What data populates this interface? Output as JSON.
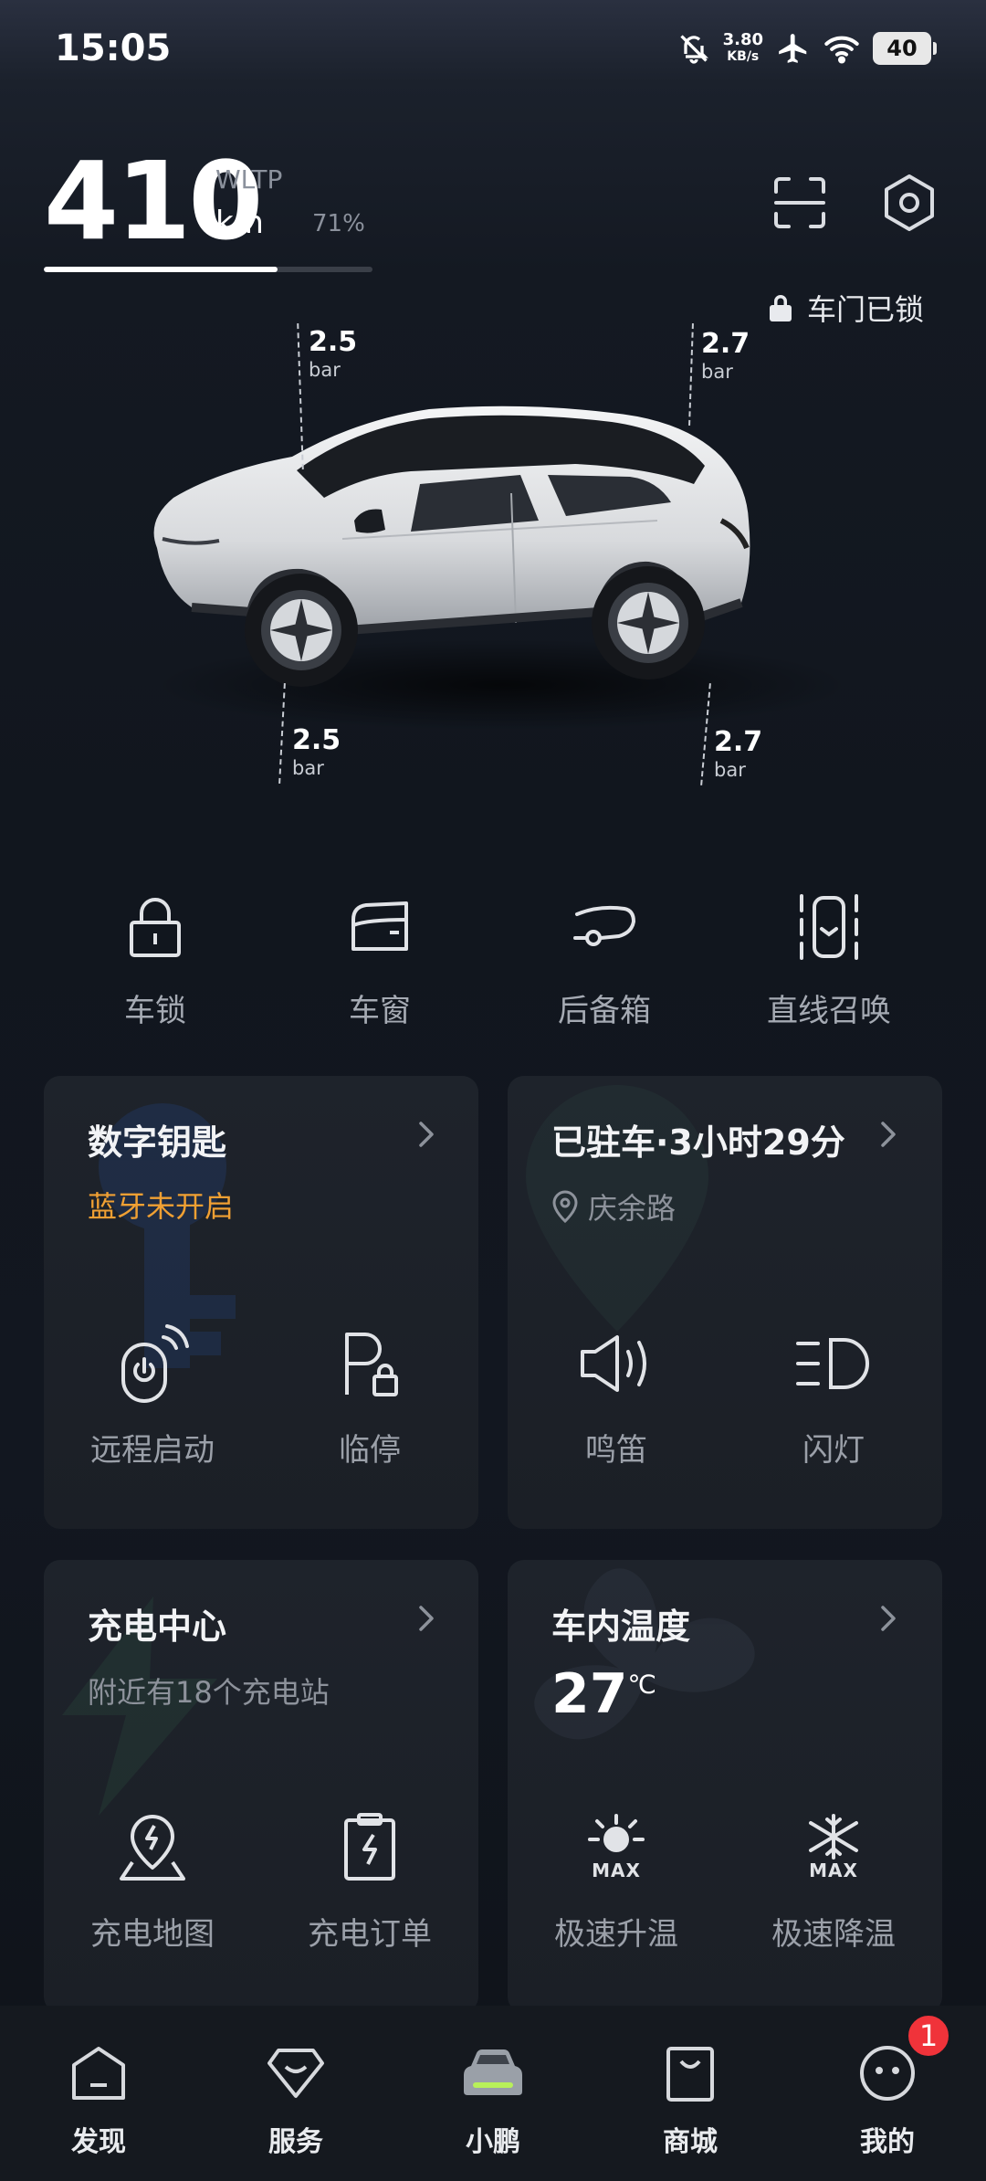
{
  "status_bar": {
    "time": "15:05",
    "net_speed": "3.80",
    "net_speed_unit": "KB/s",
    "battery": "40",
    "icons": [
      "mute-bell-icon",
      "airplane-icon",
      "wifi-icon",
      "battery-icon"
    ]
  },
  "range": {
    "value": "410",
    "standard": "WLTP",
    "unit": "km",
    "percent_label": "71%",
    "percent": 71
  },
  "door_status": "车门已锁",
  "tires": {
    "front_top": {
      "value": "2.5",
      "unit": "bar"
    },
    "rear_top": {
      "value": "2.7",
      "unit": "bar"
    },
    "front_bottom": {
      "value": "2.5",
      "unit": "bar"
    },
    "rear_bottom": {
      "value": "2.7",
      "unit": "bar"
    }
  },
  "quick_actions": [
    {
      "label": "车锁",
      "icon": "lock-icon"
    },
    {
      "label": "车窗",
      "icon": "window-icon"
    },
    {
      "label": "后备箱",
      "icon": "trunk-icon"
    },
    {
      "label": "直线召唤",
      "icon": "summon-icon"
    }
  ],
  "cards": {
    "digital_key": {
      "title": "数字钥匙",
      "status": "蓝牙未开启",
      "actions": [
        {
          "label": "远程启动",
          "icon": "remote-start-icon"
        },
        {
          "label": "临停",
          "icon": "temporary-park-icon"
        }
      ]
    },
    "parking": {
      "title": "已驻车·3小时29分",
      "location": "庆余路",
      "actions": [
        {
          "label": "鸣笛",
          "icon": "horn-icon"
        },
        {
          "label": "闪灯",
          "icon": "flash-lights-icon"
        }
      ]
    },
    "charging": {
      "title": "充电中心",
      "subtitle": "附近有18个充电站",
      "actions": [
        {
          "label": "充电地图",
          "icon": "charging-map-icon"
        },
        {
          "label": "充电订单",
          "icon": "charging-order-icon"
        }
      ]
    },
    "climate": {
      "title": "车内温度",
      "temperature": "27",
      "temp_unit": "℃",
      "actions": [
        {
          "label": "极速升温",
          "icon": "max-heat-icon",
          "badge": "MAX"
        },
        {
          "label": "极速降温",
          "icon": "max-cool-icon",
          "badge": "MAX"
        }
      ]
    }
  },
  "bottom_nav": [
    {
      "label": "发现",
      "icon": "discover-icon"
    },
    {
      "label": "服务",
      "icon": "service-icon"
    },
    {
      "label": "小鹏",
      "icon": "car-icon",
      "active": true
    },
    {
      "label": "商城",
      "icon": "shop-icon"
    },
    {
      "label": "我的",
      "icon": "profile-icon",
      "badge": "1"
    }
  ],
  "colors": {
    "accent_green": "#b8f05a",
    "alert_orange": "#f0a033",
    "badge_red": "#f0333a"
  }
}
